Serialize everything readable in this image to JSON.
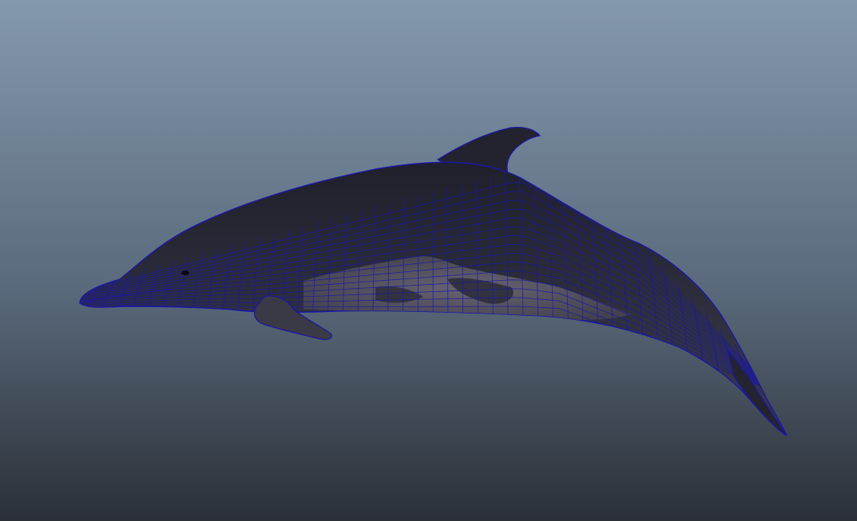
{
  "viewport": {
    "background_top": "#8498ae",
    "background_bottom": "#2b3037"
  },
  "model": {
    "name": "dolphin-mesh",
    "shading": "smooth-shaded-with-wireframe",
    "wireframe_color": "#1a17a8",
    "body_color": "#2a2b39",
    "belly_color": "#5a5866"
  }
}
